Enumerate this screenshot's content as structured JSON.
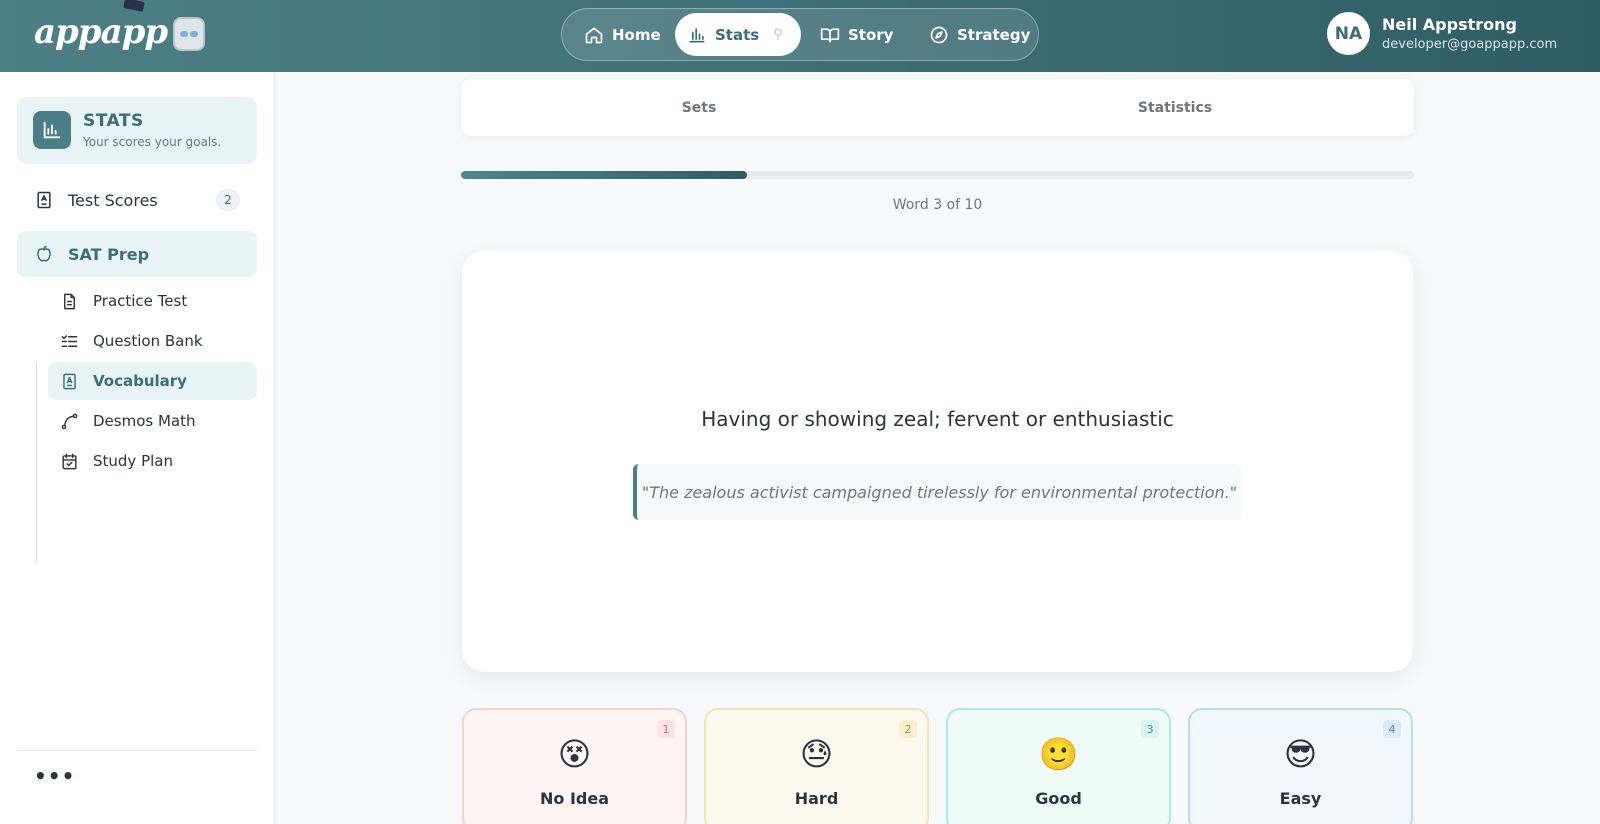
{
  "app": {
    "logo_text": "appapp"
  },
  "nav": {
    "home_label": "Home",
    "stats_label": "Stats",
    "story_label": "Story",
    "strategy_label": "Strategy"
  },
  "user": {
    "initials": "NA",
    "name": "Neil Appstrong",
    "email": "developer@goappapp.com"
  },
  "sidebar": {
    "header_title": "STATS",
    "header_subtitle": "Your scores your goals.",
    "test_scores_label": "Test Scores",
    "test_scores_badge": "2",
    "sat_prep_label": "SAT Prep",
    "sub_items": [
      {
        "label": "Practice Test"
      },
      {
        "label": "Question Bank"
      },
      {
        "label": "Vocabulary"
      },
      {
        "label": "Desmos Math"
      },
      {
        "label": "Study Plan"
      }
    ],
    "more_label": "•••"
  },
  "tabs": {
    "sets_label": "Sets",
    "statistics_label": "Statistics"
  },
  "progress": {
    "current": 3,
    "total": 10,
    "fraction": 0.3,
    "label": "Word 3 of 10"
  },
  "card": {
    "definition": "Having or showing zeal; fervent or enthusiastic",
    "example": "\"The zealous activist campaigned tirelessly for environmental protection.\""
  },
  "answers": [
    {
      "key": "1",
      "emoji": "😵",
      "label": "No Idea"
    },
    {
      "key": "2",
      "emoji": "😓",
      "label": "Hard"
    },
    {
      "key": "3",
      "emoji": "🙂",
      "label": "Good"
    },
    {
      "key": "4",
      "emoji": "😎",
      "label": "Easy"
    }
  ],
  "colors": {
    "accent": "#3b6e78",
    "header_gradient_start": "#4d7f86",
    "header_gradient_end": "#2f5d66"
  }
}
